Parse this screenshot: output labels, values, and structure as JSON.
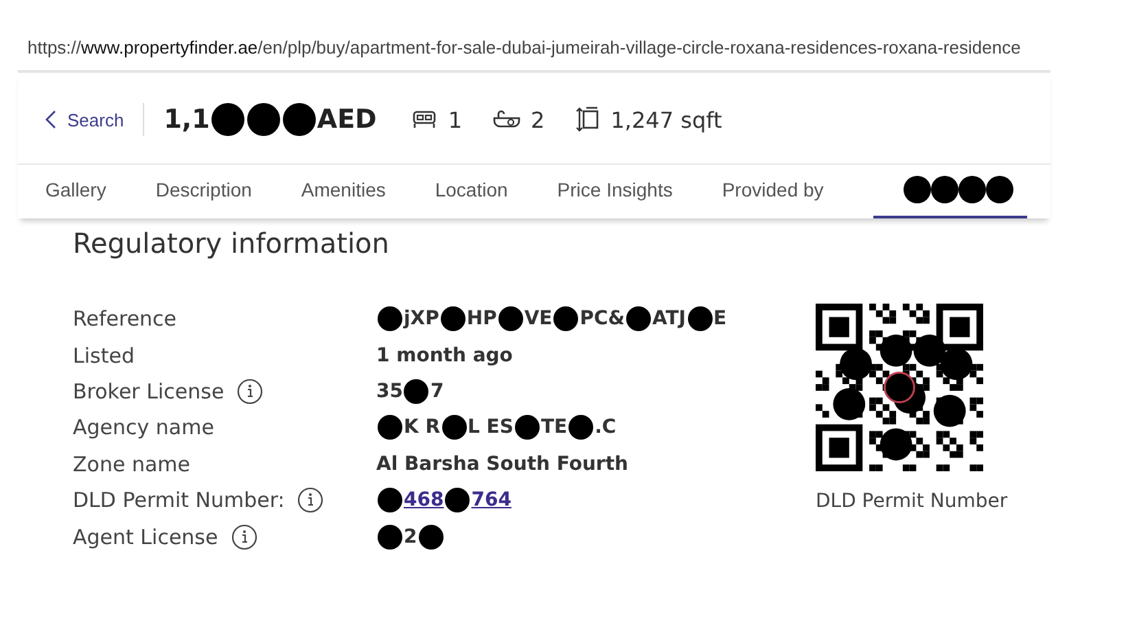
{
  "address_bar": {
    "url_prefix": "https://",
    "url_domain": "www.propertyfinder.ae",
    "url_path": "/en/plp/buy/apartment-for-sale-dubai-jumeirah-village-circle-roxana-residences-roxana-residence"
  },
  "header": {
    "back_label": "Search",
    "price_parts": [
      {
        "kind": "text",
        "text": "1,1"
      },
      {
        "kind": "dot"
      },
      {
        "kind": "dot"
      },
      {
        "kind": "dot"
      },
      {
        "kind": "text",
        "text": "AED"
      }
    ],
    "features": [
      {
        "kind": "bed",
        "text": "1"
      },
      {
        "kind": "bath",
        "text": "2"
      },
      {
        "kind": "area",
        "text": "1,247 sqft"
      }
    ]
  },
  "tabs": [
    {
      "kind": "text",
      "label": "Gallery",
      "selected": false
    },
    {
      "kind": "text",
      "label": "Description",
      "selected": false
    },
    {
      "kind": "text",
      "label": "Amenities",
      "selected": false
    },
    {
      "kind": "text",
      "label": "Location",
      "selected": false
    },
    {
      "kind": "text",
      "label": "Price Insights",
      "selected": false
    },
    {
      "kind": "text",
      "label": "Provided by",
      "selected": false
    },
    {
      "kind": "redacted",
      "selected": true
    }
  ],
  "section": {
    "title": "Regulatory information",
    "rows": [
      {
        "label": "Reference",
        "info": false,
        "link": false,
        "parts": [
          {
            "kind": "dot"
          },
          {
            "kind": "text",
            "text": "jXP"
          },
          {
            "kind": "dot"
          },
          {
            "kind": "text",
            "text": "HP"
          },
          {
            "kind": "dot"
          },
          {
            "kind": "text",
            "text": "VE"
          },
          {
            "kind": "dot"
          },
          {
            "kind": "text",
            "text": "PC&"
          },
          {
            "kind": "dot"
          },
          {
            "kind": "text",
            "text": "ATJ"
          },
          {
            "kind": "dot"
          },
          {
            "kind": "text",
            "text": "E"
          }
        ]
      },
      {
        "label": "Listed",
        "info": false,
        "link": false,
        "parts": [
          {
            "kind": "text",
            "text": "1 month ago"
          }
        ]
      },
      {
        "label": "Broker License",
        "info": true,
        "link": false,
        "parts": [
          {
            "kind": "text",
            "text": "35"
          },
          {
            "kind": "dot"
          },
          {
            "kind": "text",
            "text": "7"
          }
        ]
      },
      {
        "label": "Agency name",
        "info": false,
        "link": false,
        "parts": [
          {
            "kind": "dot"
          },
          {
            "kind": "text",
            "text": "K R"
          },
          {
            "kind": "dot"
          },
          {
            "kind": "text",
            "text": "L ES"
          },
          {
            "kind": "dot"
          },
          {
            "kind": "text",
            "text": "TE"
          },
          {
            "kind": "dot"
          },
          {
            "kind": "text",
            "text": ".C"
          }
        ]
      },
      {
        "label": "Zone name",
        "info": false,
        "link": false,
        "parts": [
          {
            "kind": "text",
            "text": "Al Barsha South Fourth"
          }
        ]
      },
      {
        "label": "DLD Permit Number:",
        "info": true,
        "link": true,
        "parts": [
          {
            "kind": "dot"
          },
          {
            "kind": "text",
            "text": "468"
          },
          {
            "kind": "dot"
          },
          {
            "kind": "text",
            "text": "764"
          }
        ]
      },
      {
        "label": "Agent License",
        "info": true,
        "link": false,
        "parts": [
          {
            "kind": "dot"
          },
          {
            "kind": "text",
            "text": "2"
          },
          {
            "kind": "dot"
          }
        ]
      }
    ],
    "qr_caption": "DLD Permit Number"
  }
}
